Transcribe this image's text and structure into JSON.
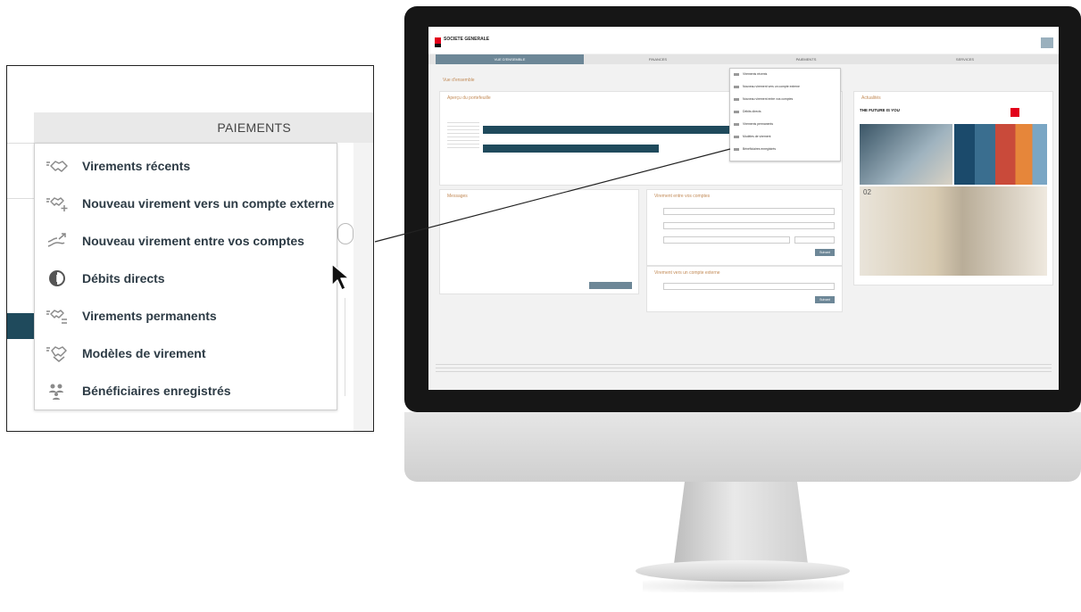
{
  "callout": {
    "tab_label": "PAIEMENTS",
    "menu_items": [
      {
        "icon": "handshake-icon",
        "label": "Virements récents"
      },
      {
        "icon": "handshake-plus-icon",
        "label": "Nouveau virement vers un compte externe"
      },
      {
        "icon": "transfer-arrows-icon",
        "label": "Nouveau virement entre vos comptes"
      },
      {
        "icon": "direct-debit-icon",
        "label": "Débits directs"
      },
      {
        "icon": "handshake-recurring-icon",
        "label": "Virements permanents"
      },
      {
        "icon": "template-handshake-icon",
        "label": "Modèles de virement"
      },
      {
        "icon": "beneficiaries-icon",
        "label": "Bénéficiaires enregistrés"
      }
    ]
  },
  "colors": {
    "menu_text": "#2d3b45",
    "icon_gray": "#8a8a8a",
    "accent_dark": "#1f4a5c",
    "nav_active": "#6d8797",
    "brand_red": "#e2001a",
    "panel_title": "#c28a56"
  },
  "screen": {
    "logo_text": "SOCIETE GENERALE",
    "nav_items": [
      "VUE D'ENSEMBLE",
      "FINANCES",
      "PAIEMENTS",
      "SERVICES"
    ],
    "dropdown_items": [
      "Virements récents",
      "Nouveau virement vers un compte externe",
      "Nouveau virement entre vos comptes",
      "Débits directs",
      "Virements permanents",
      "Modèles de virement",
      "Bénéficiaires enregistrés"
    ],
    "welcome_title": "Vue d'ensemble",
    "overview_title": "Aperçu du portefeuille",
    "messages_title": "Messages",
    "transfer_between_title": "Virement entre vos comptes",
    "transfer_external_title": "Virement vers un compte externe",
    "news_title": "Actualités",
    "news_headline": "THE FUTURE IS YOU",
    "news_date": "02",
    "button_label": "Suivant"
  }
}
